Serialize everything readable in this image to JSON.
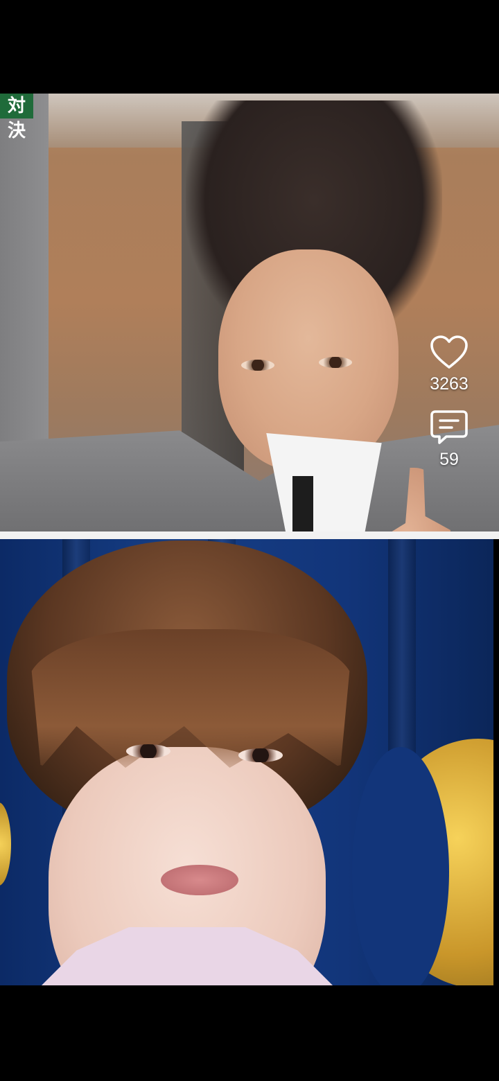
{
  "photos": {
    "top_caption": "対決"
  },
  "actions": {
    "like": {
      "icon": "heart-icon",
      "count": "3263"
    },
    "comment": {
      "icon": "comment-icon",
      "count": "59"
    }
  },
  "colors": {
    "background": "#000000",
    "icon_color": "#ffffff",
    "divider": "#f2f2f2"
  }
}
